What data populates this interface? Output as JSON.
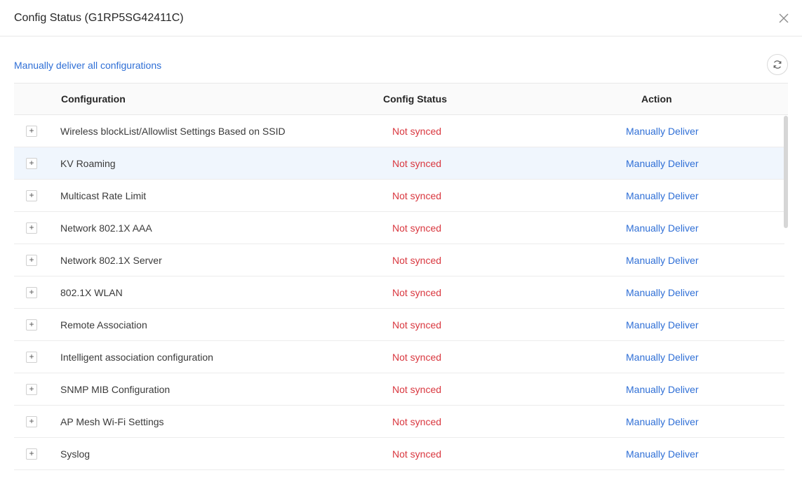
{
  "modal": {
    "title": "Config Status (G1RP5SG42411C)"
  },
  "toolbar": {
    "deliver_all_label": "Manually deliver all configurations"
  },
  "table": {
    "headers": {
      "configuration": "Configuration",
      "status": "Config Status",
      "action": "Action"
    },
    "expand_symbol": "+",
    "rows": [
      {
        "name": "Wireless blockList/Allowlist Settings Based on SSID",
        "status": "Not synced",
        "action": "Manually Deliver"
      },
      {
        "name": "KV Roaming",
        "status": "Not synced",
        "action": "Manually Deliver"
      },
      {
        "name": "Multicast Rate Limit",
        "status": "Not synced",
        "action": "Manually Deliver"
      },
      {
        "name": "Network 802.1X AAA",
        "status": "Not synced",
        "action": "Manually Deliver"
      },
      {
        "name": "Network 802.1X Server",
        "status": "Not synced",
        "action": "Manually Deliver"
      },
      {
        "name": "802.1X WLAN",
        "status": "Not synced",
        "action": "Manually Deliver"
      },
      {
        "name": "Remote Association",
        "status": "Not synced",
        "action": "Manually Deliver"
      },
      {
        "name": "Intelligent association configuration",
        "status": "Not synced",
        "action": "Manually Deliver"
      },
      {
        "name": "SNMP MIB Configuration",
        "status": "Not synced",
        "action": "Manually Deliver"
      },
      {
        "name": "AP Mesh Wi-Fi Settings",
        "status": "Not synced",
        "action": "Manually Deliver"
      },
      {
        "name": "Syslog",
        "status": "Not synced",
        "action": "Manually Deliver"
      }
    ]
  },
  "colors": {
    "link": "#2f6fd6",
    "error": "#d9363e",
    "row_highlight": "#f0f6fd"
  },
  "icons": {
    "close": "close-icon",
    "refresh": "refresh-icon",
    "expand": "plus-icon"
  }
}
